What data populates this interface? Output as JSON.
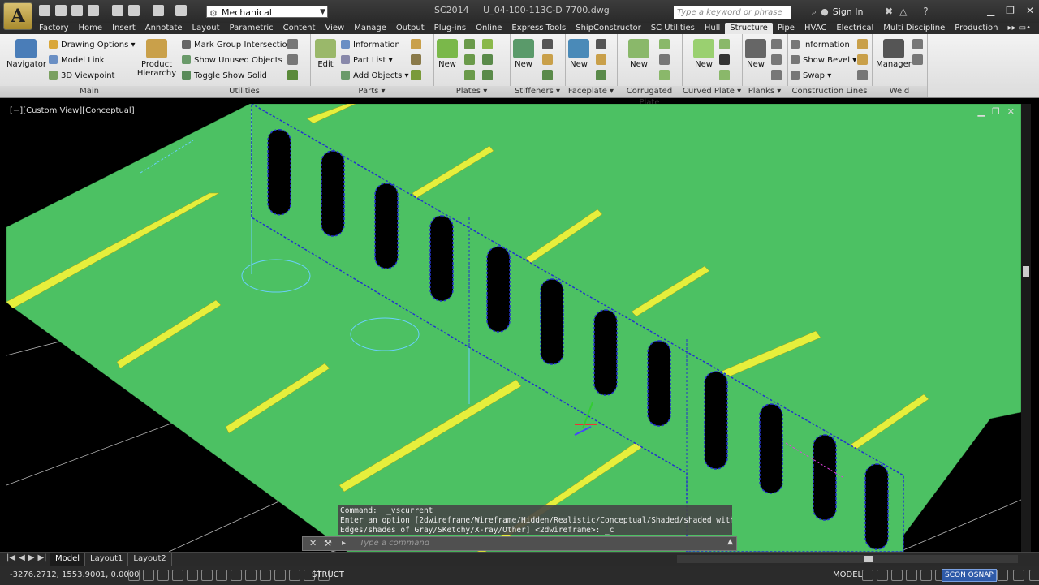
{
  "title_bar": {
    "app_logo_letter": "A",
    "workspace": "Mechanical",
    "version_label": "SC2014",
    "document_name": "U_04-100-113C-D 7700.dwg",
    "search_placeholder": "Type a keyword or phrase",
    "sign_in": "Sign In"
  },
  "ribbon_tabs": [
    "Factory",
    "Home",
    "Insert",
    "Annotate",
    "Layout",
    "Parametric",
    "Content",
    "View",
    "Manage",
    "Output",
    "Plug-ins",
    "Online",
    "Express Tools",
    "ShipConstructor",
    "SC Utilities",
    "Hull",
    "Structure",
    "Pipe",
    "HVAC",
    "Electrical",
    "Multi Discipline",
    "Production"
  ],
  "active_tab": "Structure",
  "panels": {
    "main": {
      "title": "Main",
      "navigator": "Navigator",
      "drawing_options": "Drawing Options",
      "model_link": "Model Link",
      "viewpoint": "3D Viewpoint",
      "product_hierarchy": "Product Hierarchy"
    },
    "utilities": {
      "title": "Utilities",
      "mark_group": "Mark Group Intersections",
      "show_unused": "Show Unused Objects",
      "toggle_show_solid": "Toggle Show Solid"
    },
    "parts": {
      "title": "Parts",
      "edit": "Edit",
      "information": "Information",
      "part_list": "Part List",
      "add_objects": "Add Objects"
    },
    "plates": {
      "title": "Plates",
      "new": "New"
    },
    "stiffeners": {
      "title": "Stiffeners",
      "new": "New"
    },
    "faceplate": {
      "title": "Faceplate",
      "new": "New"
    },
    "corrugated": {
      "title": "Corrugated Plate",
      "new": "New"
    },
    "curved": {
      "title": "Curved Plate",
      "new": "New"
    },
    "planks": {
      "title": "Planks",
      "new": "New"
    },
    "construction": {
      "title": "Construction Lines",
      "information": "Information",
      "show_bevel": "Show Bevel",
      "swap": "Swap"
    },
    "weld": {
      "title": "Weld",
      "manager": "Manager"
    }
  },
  "viewport": {
    "label": "[−][Custom View][Conceptual]"
  },
  "command": {
    "history": [
      "Command:  _vscurrent",
      "Enter an option [2dwireframe/Wireframe/Hidden/Realistic/Conceptual/Shaded/shaded with",
      "Edges/shades of Gray/SKetchy/X-ray/Other] <2dwireframe>: _c"
    ],
    "placeholder": "Type a command"
  },
  "layout_tabs": [
    "Model",
    "Layout1",
    "Layout2"
  ],
  "active_layout": "Model",
  "status": {
    "coords": "-3276.2712, 1553.9001, 0.0000",
    "struct": "STRUCT",
    "model": "MODEL",
    "osnap": "SCON OSNAP"
  },
  "colors": {
    "plate": "#4cc163",
    "stiffener": "#e6ef3c",
    "outline": "#2233cc",
    "background": "#000000",
    "active_tab": "#e8e8e8"
  }
}
